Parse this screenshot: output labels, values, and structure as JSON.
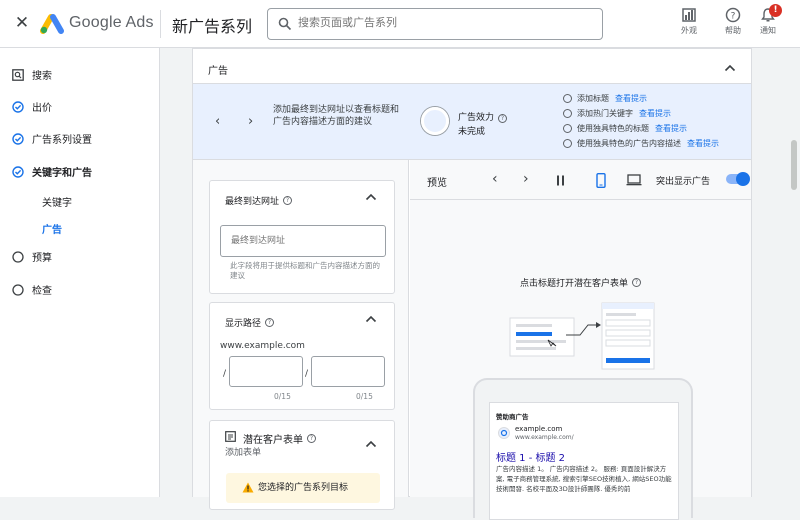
{
  "header": {
    "brand": "Google Ads",
    "page_title": "新广告系列",
    "search_placeholder": "搜索页面或广告系列",
    "actions": [
      {
        "label": "外观",
        "icon": "appearance-icon"
      },
      {
        "label": "帮助",
        "icon": "help-icon"
      },
      {
        "label": "通知",
        "icon": "notifications-icon",
        "badge": "!"
      }
    ]
  },
  "sidebar": {
    "items": [
      {
        "label": "搜索",
        "state": "current-step"
      },
      {
        "label": "出价",
        "state": "done"
      },
      {
        "label": "广告系列设置",
        "state": "done"
      },
      {
        "label": "关键字和广告",
        "state": "done"
      },
      {
        "label": "预算",
        "state": "todo"
      },
      {
        "label": "检查",
        "state": "todo"
      }
    ],
    "subitems": [
      {
        "label": "关键字"
      },
      {
        "label": "广告",
        "active": true
      }
    ]
  },
  "ad_section": {
    "title": "广告",
    "strength": {
      "description": "添加最终到达网址以查看标题和广告内容描述方面的建议",
      "title": "广告效力",
      "value": "未完成"
    },
    "tips": [
      {
        "label": "添加标题",
        "link": "查看提示"
      },
      {
        "label": "添加热门关键字",
        "link": "查看提示"
      },
      {
        "label": "使用独具特色的标题",
        "link": "查看提示"
      },
      {
        "label": "使用独具特色的广告内容描述",
        "link": "查看提示"
      }
    ]
  },
  "final_url": {
    "title": "最终到达网址",
    "placeholder": "最终到达网址",
    "hint": "此字段将用于提供标题和广告内容描述方面的建议"
  },
  "display_path": {
    "title": "显示路径",
    "base": "www.example.com",
    "sep": "/",
    "counter1": "0/15",
    "counter2": "0/15"
  },
  "lead_form": {
    "title": "潜在客户表单",
    "subtitle": "添加表单",
    "warning": "您选择的广告系列目标"
  },
  "preview": {
    "label": "预览",
    "highlight_label": "突出显示广告",
    "highlight_on": true,
    "tap_headline_text": "点击标题打开潜在客户表单",
    "ad": {
      "sponsored": "赞助商广告",
      "domain": "example.com",
      "url": "www.example.com/",
      "headline": "标题 1 - 标题 2",
      "body": "广告内容描述 1。 广告内容描述 2。 服務: 頁面設計解決方案, 電子商務管理系統, 搜索引擎SEO技術植入, 網站SEO功能技術開發. 名校平面及3D設計師團隊. 優秀的前"
    }
  },
  "colors": {
    "accent": "#1a73e8",
    "banner": "#e8f0fe",
    "warning": "#fef7e0"
  }
}
